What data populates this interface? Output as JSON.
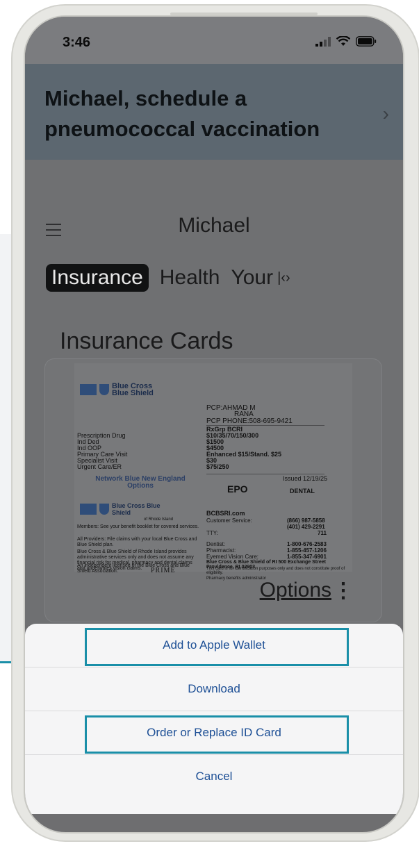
{
  "status_bar": {
    "time": "3:46"
  },
  "banner": {
    "text": "Michael, schedule a pneumococcal vaccination"
  },
  "nav": {
    "name": "Michael"
  },
  "tabs": [
    {
      "label": "Insurance",
      "active": true
    },
    {
      "label": "Health",
      "active": false
    },
    {
      "label": "Your",
      "active": false
    }
  ],
  "section_title": "Insurance Cards",
  "id_card": {
    "brand": "Blue Cross Blue Shield",
    "brand_sub": "of Rhode Island",
    "pcp_name": "PCP:AHMAD M",
    "pcp_name2": "RANA",
    "pcp_phone": "PCP PHONE:508-695-9421",
    "rxgrp": "RxGrp  BCRI",
    "copay_values": [
      "$10/35/70/150/300",
      "$1500",
      "$4500",
      "Enhanced $15/Stand. $25",
      "$30",
      "$75/250"
    ],
    "copay_labels": [
      "Prescription Drug",
      "Ind Ded",
      "Ind OOP",
      "Primary Care Visit",
      "Specialist Visit",
      "Urgent Care/ER"
    ],
    "issued": "Issued 12/19/25",
    "network": "Network Blue New England Options",
    "plan": "EPO",
    "dental": "DENTAL",
    "back_left": [
      "Members: See your benefit booklet for covered services.",
      "All Providers: File claims with your local Blue Cross and Blue Shield plan.",
      "Blue Cross & Blue Shield of Rhode Island provides administrative services only and does not assume any financial risk for medical, pharmacy and dental claims and underwrites vision claims.",
      "An independent licensee of the Blue Cross and Blue Shield Association."
    ],
    "website": "BCBSRI.com",
    "back_rows": [
      {
        "label": "Customer Service:",
        "value": "(866) 987-5858"
      },
      {
        "label": "",
        "value": "(401) 429-2291"
      },
      {
        "label": "TTY:",
        "value": "711"
      },
      {
        "label": "Dentist:",
        "value": "1-800-676-2583"
      },
      {
        "label": "Pharmacist:",
        "value": "1-855-457-1206"
      },
      {
        "label": "Eyemed Vision Care:",
        "value": "1-855-347-6901"
      }
    ],
    "back_address": "Blue Cross & Blue Shield of RI 500 Exchange Street Providence, RI 02903",
    "back_note": "This card is for identification purposes only and does not constitute proof of eligibility.",
    "pharmacy_admin": "Pharmacy benefits administrator",
    "prime": "PRIME"
  },
  "card_actions": {
    "options_label": "Options",
    "more_icon": "kebab-icon"
  },
  "action_sheet": {
    "items": [
      {
        "label": "Add to Apple Wallet"
      },
      {
        "label": "Download"
      },
      {
        "label": "Order or Replace ID Card"
      },
      {
        "label": "Cancel"
      }
    ]
  },
  "colors": {
    "highlight": "#1a8fa8",
    "link": "#1d4f95",
    "banner_bg": "#5c6770"
  }
}
